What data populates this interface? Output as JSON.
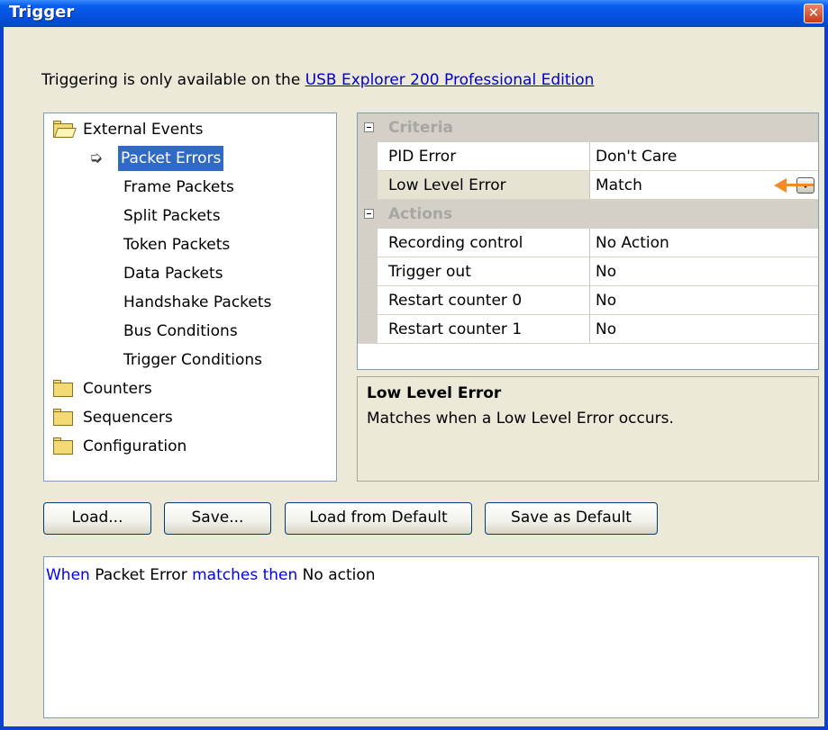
{
  "window": {
    "title": "Trigger",
    "close_label": "✕"
  },
  "info": {
    "prefix": "Triggering is only available on the ",
    "link": "USB Explorer 200 Professional Edition"
  },
  "tree": {
    "items": [
      {
        "label": "External Events",
        "icon": "open-folder-icon"
      },
      {
        "label": "Packet Errors",
        "selected": true
      },
      {
        "label": "Frame Packets"
      },
      {
        "label": "Split Packets"
      },
      {
        "label": "Token Packets"
      },
      {
        "label": "Data Packets"
      },
      {
        "label": "Handshake Packets"
      },
      {
        "label": "Bus Conditions"
      },
      {
        "label": "Trigger Conditions"
      },
      {
        "label": "Counters",
        "icon": "folder-icon"
      },
      {
        "label": "Sequencers",
        "icon": "folder-icon"
      },
      {
        "label": "Configuration",
        "icon": "folder-icon"
      }
    ]
  },
  "grid": {
    "criteria_title": "Criteria",
    "actions_title": "Actions",
    "criteria": [
      {
        "name": "PID Error",
        "value": "Don't Care"
      },
      {
        "name": "Low Level Error",
        "value": "Match"
      }
    ],
    "actions": [
      {
        "name": "Recording control",
        "value": "No Action"
      },
      {
        "name": "Trigger out",
        "value": "No"
      },
      {
        "name": "Restart counter 0",
        "value": "No"
      },
      {
        "name": "Restart counter 1",
        "value": "No"
      }
    ]
  },
  "description": {
    "title": "Low Level Error",
    "text": "Matches when a Low Level Error occurs."
  },
  "buttons": {
    "load": "Load...",
    "save": "Save...",
    "load_default": "Load from Default",
    "save_default": "Save as Default"
  },
  "summary": {
    "when": "When",
    "subject": " Packet Error ",
    "matches_then": "matches then",
    "action": " No action"
  },
  "colors": {
    "titlebar": "#0550e0",
    "selection": "#316ac5",
    "keyword": "#0000ee",
    "pointer": "#f28c1f"
  }
}
